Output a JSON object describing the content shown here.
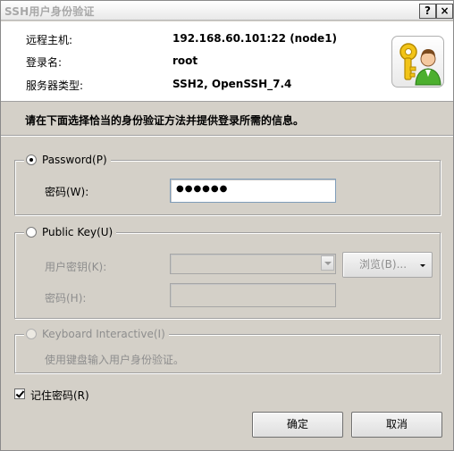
{
  "window": {
    "title": "SSH用户身份验证",
    "help_label": "?",
    "close_label": "×"
  },
  "info": {
    "host_label": "远程主机:",
    "host_value": "192.168.60.101:22 (node1)",
    "login_label": "登录名:",
    "login_value": "root",
    "server_type_label": "服务器类型:",
    "server_type_value": "SSH2, OpenSSH_7.4",
    "icon": "user-key-icon"
  },
  "instruction": "请在下面选择恰当的身份验证方法并提供登录所需的信息。",
  "password_group": {
    "label": "Password(P)",
    "selected": true,
    "field_label": "密码(W):",
    "field_value_masked": "●●●●●●"
  },
  "pubkey_group": {
    "label": "Public Key(U)",
    "selected": false,
    "user_key_label": "用户密钥(K):",
    "user_key_value": "",
    "browse_label": "浏览(B)...",
    "passphrase_label": "密码(H):",
    "passphrase_value": ""
  },
  "keyboard_group": {
    "label": "Keyboard Interactive(I)",
    "selected": false,
    "description": "使用键盘输入用户身份验证。"
  },
  "remember": {
    "label": "记住密码(R)",
    "checked": true
  },
  "buttons": {
    "ok": "确定",
    "cancel": "取消"
  }
}
